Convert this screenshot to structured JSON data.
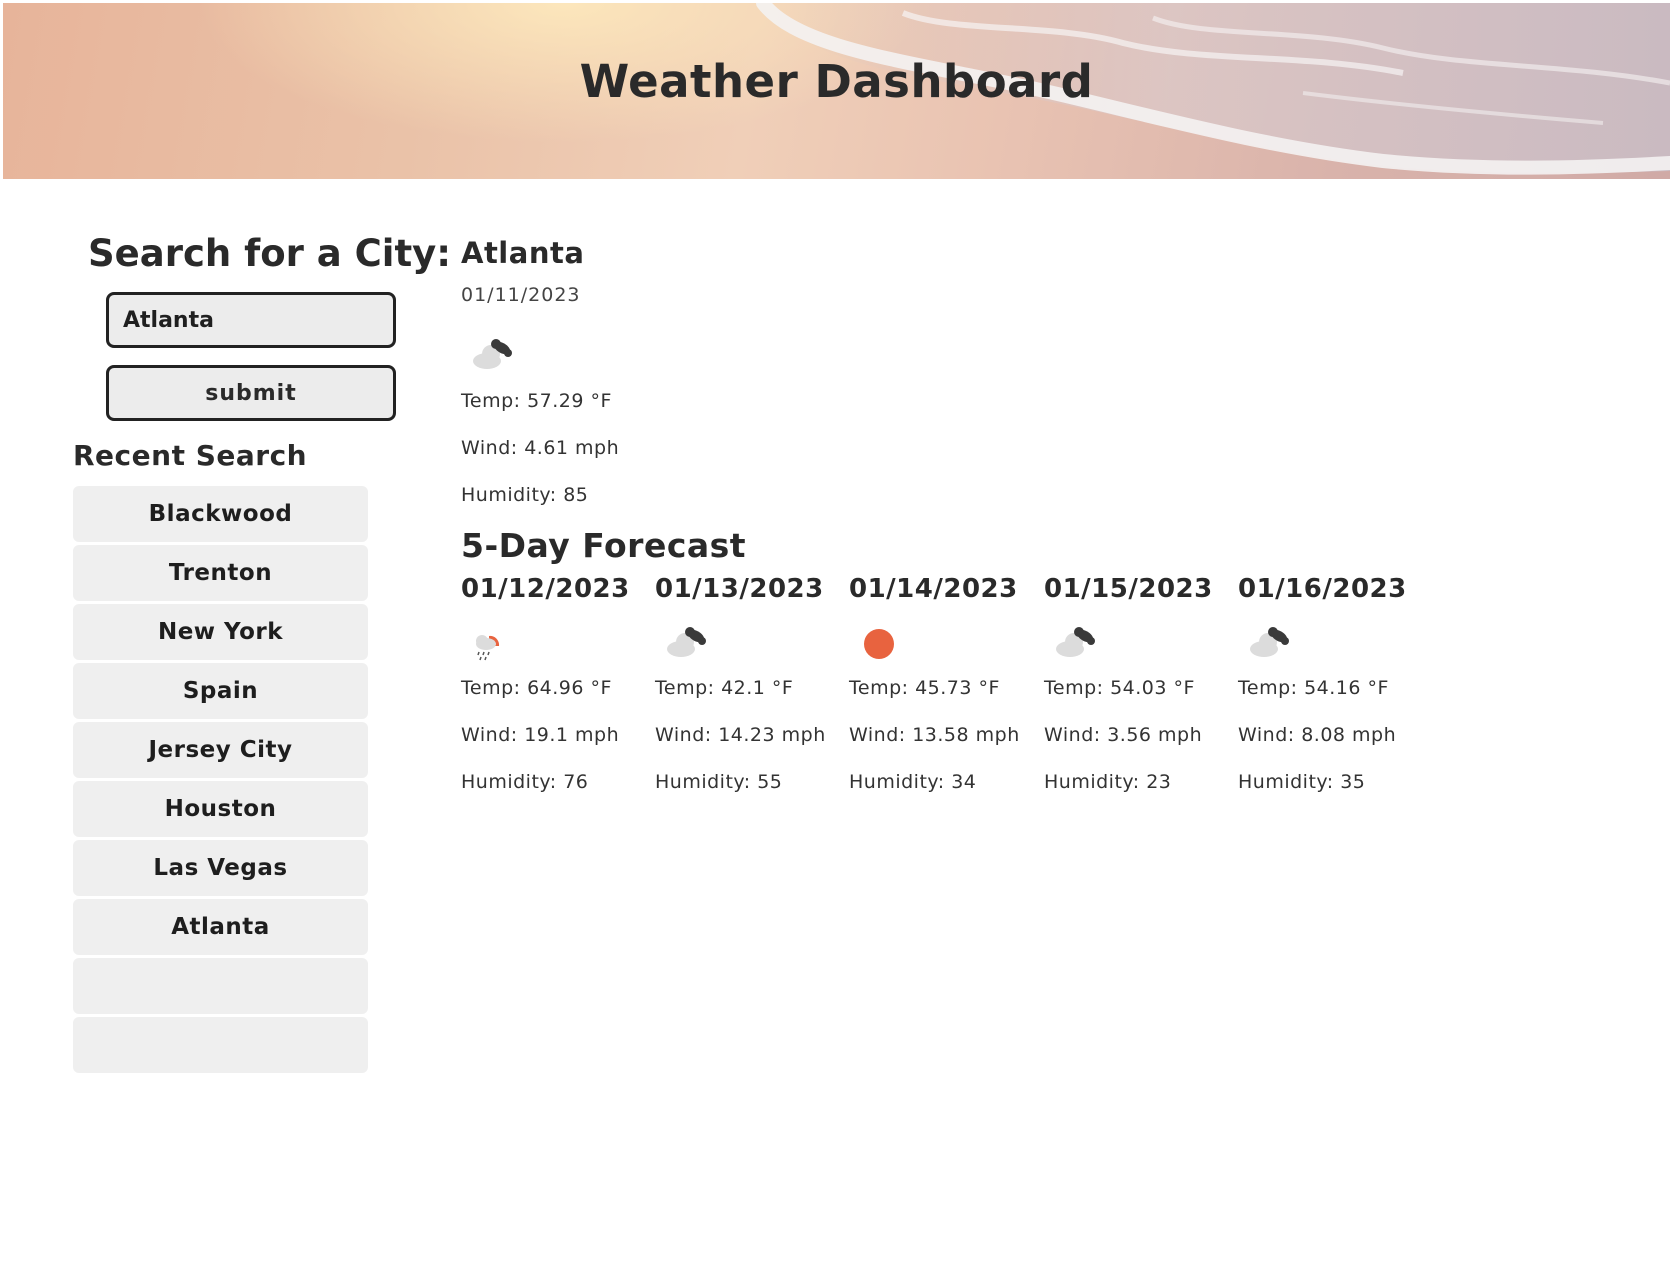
{
  "header": {
    "title": "Weather Dashboard"
  },
  "search": {
    "heading": "Search for a City:",
    "input_value": "Atlanta",
    "submit_label": "submit"
  },
  "recent": {
    "heading": "Recent Search",
    "items": [
      "Blackwood",
      "Trenton",
      "New York",
      "Spain",
      "Jersey City",
      "Houston",
      "Las Vegas",
      "Atlanta",
      "",
      ""
    ]
  },
  "current": {
    "city": "Atlanta",
    "date": "01/11/2023",
    "icon": "cloud-icon",
    "temp": "Temp: 57.29 °F",
    "wind": "Wind: 4.61 mph",
    "humidity": "Humidity: 85"
  },
  "forecast": {
    "heading": "5-Day Forecast",
    "days": [
      {
        "date": "01/12/2023",
        "icon": "rain-sun-icon",
        "temp": "Temp: 64.96 °F",
        "wind": "Wind: 19.1 mph",
        "humidity": "Humidity: 76"
      },
      {
        "date": "01/13/2023",
        "icon": "cloud-icon",
        "temp": "Temp: 42.1 °F",
        "wind": "Wind: 14.23 mph",
        "humidity": "Humidity: 55"
      },
      {
        "date": "01/14/2023",
        "icon": "sun-icon",
        "temp": "Temp: 45.73 °F",
        "wind": "Wind: 13.58 mph",
        "humidity": "Humidity: 34"
      },
      {
        "date": "01/15/2023",
        "icon": "cloud-icon",
        "temp": "Temp: 54.03 °F",
        "wind": "Wind: 3.56 mph",
        "humidity": "Humidity: 23"
      },
      {
        "date": "01/16/2023",
        "icon": "cloud-icon",
        "temp": "Temp: 54.16 °F",
        "wind": "Wind: 8.08 mph",
        "humidity": "Humidity: 35"
      }
    ]
  },
  "colors": {
    "sun": "#e8633f",
    "cloud_light": "#dcdcdc",
    "cloud_dark": "#3a3a3a",
    "panel": "#efefef",
    "border": "#222222"
  }
}
